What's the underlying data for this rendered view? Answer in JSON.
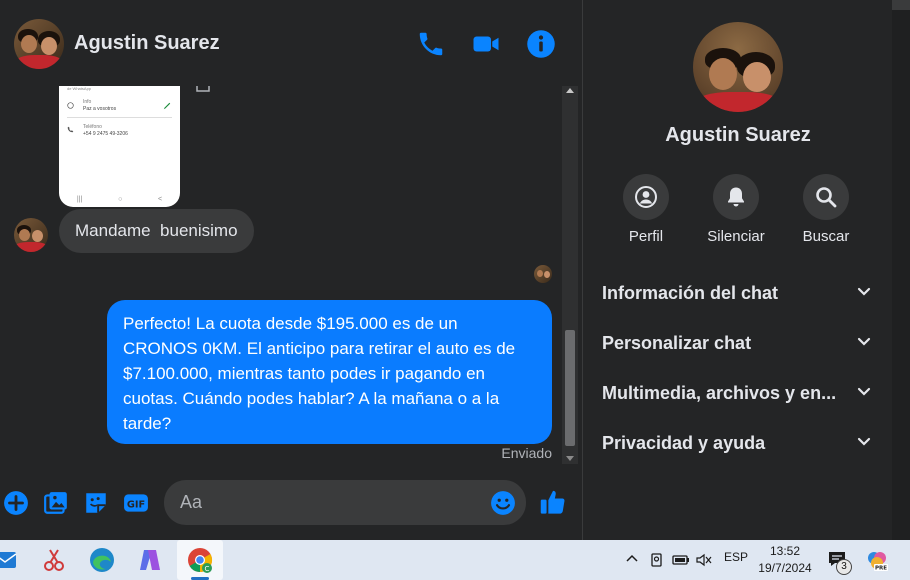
{
  "chat": {
    "contact_name": "Agustin Suarez",
    "header_icons": [
      "phone-icon",
      "video-icon",
      "info-icon"
    ],
    "screenshot_preview": {
      "lines": [
        "Info",
        "Paz a vosotros",
        "Teléfono",
        "+54 9 2475 49-3206"
      ]
    },
    "messages": [
      {
        "direction": "in",
        "text": "Mandame  buenisimo"
      },
      {
        "direction": "out",
        "text": "Perfecto! La cuota desde $195.000 es de un CRONOS 0KM. El anticipo para retirar el auto es de $7.100.000, mientras tanto podes ir pagando en cuotas. Cuándo podes hablar? A la mañana o a la tarde?"
      }
    ],
    "status": "Enviado",
    "composer": {
      "placeholder": "Aa",
      "icons": [
        "plus-icon",
        "gallery-icon",
        "sticker-icon",
        "gif-icon",
        "emoji-icon",
        "like-icon"
      ]
    }
  },
  "details": {
    "name": "Agustin Suarez",
    "actions": [
      {
        "label": "Perfil",
        "icon": "profile-icon"
      },
      {
        "label": "Silenciar",
        "icon": "bell-icon"
      },
      {
        "label": "Buscar",
        "icon": "search-icon"
      }
    ],
    "sections": [
      "Información del chat",
      "Personalizar chat",
      "Multimedia, archivos y en...",
      "Privacidad y ayuda"
    ]
  },
  "taskbar": {
    "language": "ESP",
    "time": "13:52",
    "date": "19/7/2024",
    "notification_count": "3"
  },
  "colors": {
    "accent": "#0a84ff",
    "sent_bubble": "#0a7cff",
    "received_bubble": "#3a3b3c",
    "background": "#242526"
  }
}
